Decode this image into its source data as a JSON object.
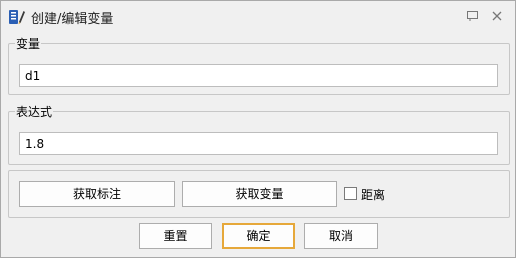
{
  "window": {
    "title": "创建/编辑变量",
    "icons": {
      "app": "pen-ruler-icon",
      "pin": "pin-icon",
      "close": "close-icon"
    }
  },
  "variable_group": {
    "label": "变量",
    "value": "d1"
  },
  "expression_group": {
    "label": "表达式",
    "value": "1.8"
  },
  "actions": {
    "get_dimension_label": "获取标注",
    "get_variable_label": "获取变量",
    "distance_checkbox": {
      "label": "距离",
      "checked": false
    }
  },
  "footer": {
    "reset_label": "重置",
    "ok_label": "确定",
    "cancel_label": "取消"
  },
  "colors": {
    "default_button_border": "#e6a83a",
    "group_border": "#c7c7c7",
    "icon_blue": "#2b5fb4"
  }
}
